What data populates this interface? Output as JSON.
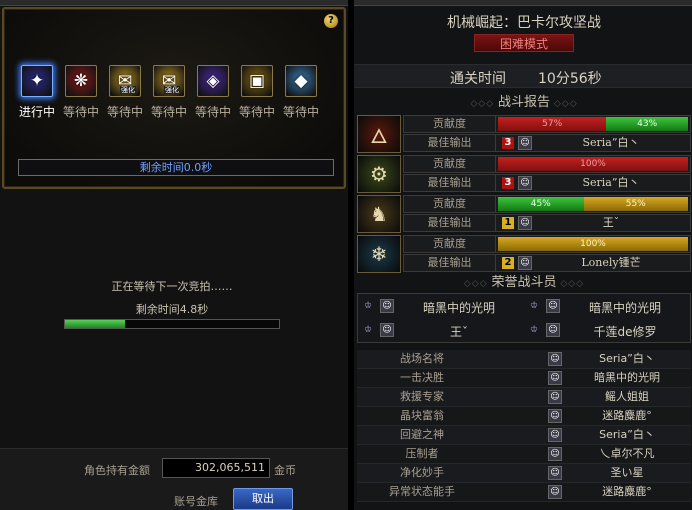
{
  "auction": {
    "slots": [
      {
        "label": "进行中",
        "icon": "purple-box-icon",
        "glyph": "✦",
        "bg": "#2a2a8a",
        "tag": ""
      },
      {
        "label": "等待中",
        "icon": "red-scroll-icon",
        "glyph": "❋",
        "bg": "#8a1a1a",
        "tag": ""
      },
      {
        "label": "等待中",
        "icon": "gold-card-icon",
        "glyph": "✉",
        "bg": "#b08a20",
        "tag": "强化"
      },
      {
        "label": "等待中",
        "icon": "gold-card-icon",
        "glyph": "✉",
        "bg": "#b08a20",
        "tag": "强化"
      },
      {
        "label": "等待中",
        "icon": "violet-crystal-icon",
        "glyph": "◈",
        "bg": "#4a2a9a",
        "tag": ""
      },
      {
        "label": "等待中",
        "icon": "treasure-chest-icon",
        "glyph": "▣",
        "bg": "#8a6a10",
        "tag": ""
      },
      {
        "label": "等待中",
        "icon": "blue-crystal-icon",
        "glyph": "◆",
        "bg": "#3a7ab0",
        "tag": ""
      }
    ],
    "remaining_time": "剩余时间0.0秒"
  },
  "waiting": {
    "message": "正在等待下一次竞拍……",
    "remaining": "剩余时间4.8秒",
    "progress": 0.28
  },
  "footer": {
    "gold_label": "角色持有金额",
    "gold_amount": "302,065,511",
    "gold_unit": "金币",
    "vault_label": "账号金库",
    "withdraw": "取出"
  },
  "report": {
    "dungeon_title": "机械崛起：巴卡尔攻坚战",
    "difficulty": "困难模式",
    "clear_label": "通关时间",
    "clear_time": "10分56秒",
    "battle_report_heading": "战斗报告",
    "contribution_label": "贡献度",
    "best_output_label": "最佳输出",
    "players": [
      {
        "portrait": "fire-class-portrait-icon",
        "glyph": "🜂",
        "pbg": "#5a1a0a",
        "segments": [
          {
            "color": "red",
            "value": 57,
            "text": "57%"
          },
          {
            "color": "green",
            "value": 43,
            "text": "43%"
          }
        ],
        "rank": "3",
        "rank_color": "red",
        "best_name": "Seria”白丶"
      },
      {
        "portrait": "green-mech-portrait-icon",
        "glyph": "⚙",
        "pbg": "#3a4a1a",
        "segments": [
          {
            "color": "red",
            "value": 100,
            "text": "100%"
          }
        ],
        "rank": "3",
        "rank_color": "red",
        "best_name": "Seria”白丶"
      },
      {
        "portrait": "gold-armor-portrait-icon",
        "glyph": "♞",
        "pbg": "#4a3a1a",
        "segments": [
          {
            "color": "green",
            "value": 45,
            "text": "45%"
          },
          {
            "color": "gold",
            "value": 55,
            "text": "55%"
          }
        ],
        "rank": "1",
        "rank_color": "gold",
        "best_name": "王ˇ"
      },
      {
        "portrait": "ice-dragon-portrait-icon",
        "glyph": "❄",
        "pbg": "#1a3a4a",
        "segments": [
          {
            "color": "gold",
            "value": 100,
            "text": "100%"
          }
        ],
        "rank": "2",
        "rank_color": "gold",
        "best_name": "Lonely锺芒"
      }
    ],
    "honor_heading": "荣誉战斗员",
    "honor": [
      "暗黑中的光明",
      "暗黑中的光明",
      "王ˇ",
      "千莲de修罗"
    ],
    "awards": [
      {
        "title": "战场名将",
        "name": "Seria”白丶"
      },
      {
        "title": "一击决胜",
        "name": "暗黑中的光明"
      },
      {
        "title": "救援专家",
        "name": "鳐人姐姐"
      },
      {
        "title": "晶块富翁",
        "name": "迷路麋鹿°"
      },
      {
        "title": "回避之神",
        "name": "Seria”白丶"
      },
      {
        "title": "压制者",
        "name": "乀卓尔不凡"
      },
      {
        "title": "净化妙手",
        "name": "圣い星"
      },
      {
        "title": "异常状态能手",
        "name": "迷路麋鹿°"
      }
    ]
  }
}
